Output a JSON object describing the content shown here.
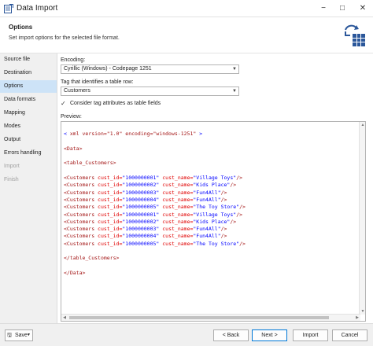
{
  "window": {
    "title": "Data Import",
    "minimize_glyph": "−",
    "maximize_glyph": "□",
    "close_glyph": "✕"
  },
  "header": {
    "title": "Options",
    "description": "Set import options for the selected file format."
  },
  "sidebar": {
    "items": [
      {
        "label": "Source file"
      },
      {
        "label": "Destination"
      },
      {
        "label": "Options"
      },
      {
        "label": "Data formats"
      },
      {
        "label": "Mapping"
      },
      {
        "label": "Modes"
      },
      {
        "label": "Output"
      },
      {
        "label": "Errors handling"
      },
      {
        "label": "Import"
      },
      {
        "label": "Finish"
      }
    ]
  },
  "options": {
    "encoding_label": "Encoding:",
    "encoding_value": "Cyrillic (Windows) - Codepage 1251",
    "tag_label": "Tag that identifies a table row:",
    "tag_value": "Customers",
    "consider_attrs_label": "Consider tag attributes as table fields",
    "consider_attrs_checked": true,
    "preview_label": "Preview:"
  },
  "preview": {
    "xml_decl": {
      "open": "<",
      "text": " xml version=\"1.0\" encoding=\"windows-1251\" ",
      "close": ">"
    },
    "data_open": "<Data>",
    "table_open": "<table_Customers>",
    "row_tag": "<Customers",
    "attr_id": " cust_id=",
    "attr_name": " cust_name=",
    "row_close": "/>",
    "rows": [
      {
        "id": "\"1000000001\"",
        "name": "\"Village Toys\""
      },
      {
        "id": "\"1000000002\"",
        "name": "\"Kids Place\""
      },
      {
        "id": "\"1000000003\"",
        "name": "\"Fun4All\""
      },
      {
        "id": "\"1000000004\"",
        "name": "\"Fun4All\""
      },
      {
        "id": "\"1000000005\"",
        "name": "\"The Toy Store\""
      },
      {
        "id": "\"1000000001\"",
        "name": "\"Village Toys\""
      },
      {
        "id": "\"1000000002\"",
        "name": "\"Kids Place\""
      },
      {
        "id": "\"1000000003\"",
        "name": "\"Fun4All\""
      },
      {
        "id": "\"1000000004\"",
        "name": "\"Fun4All\""
      },
      {
        "id": "\"1000000005\"",
        "name": "\"The Toy Store\""
      }
    ],
    "table_close": "</table_Customers>",
    "data_close": "</Data>"
  },
  "footer": {
    "save_label": "Save",
    "back_label": "< Back",
    "next_label": "Next >",
    "import_label": "Import",
    "cancel_label": "Cancel"
  },
  "icons": {
    "app": "data-import-icon",
    "header": "table-import-icon",
    "save": "floppy-disk-icon"
  },
  "colors": {
    "accent": "#0078d7",
    "active_nav": "#cde3f7",
    "xml_tag": "#a31515",
    "xml_attr": "#e00000",
    "xml_value": "#0000ff"
  }
}
